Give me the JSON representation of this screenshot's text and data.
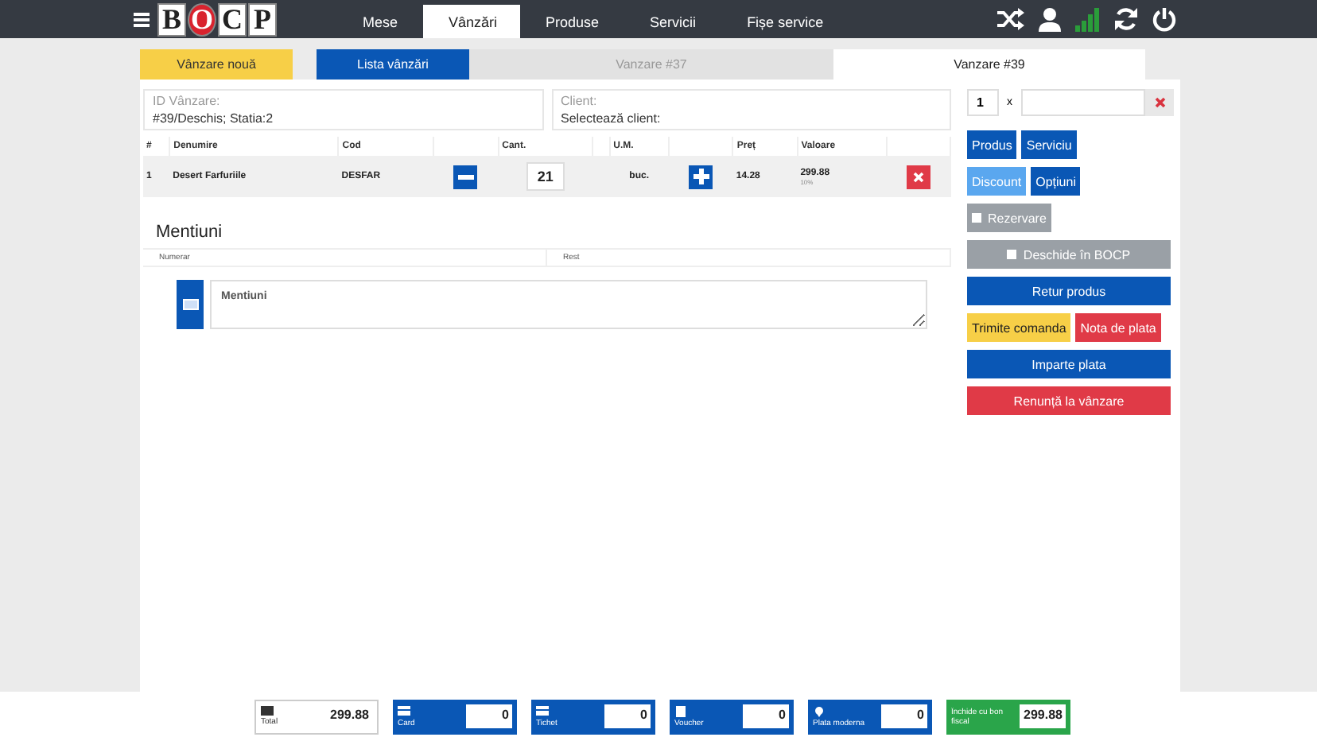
{
  "nav": {
    "logo": [
      "B",
      "O",
      "C",
      "P"
    ],
    "tabs": [
      {
        "label": "Mese",
        "selected": false
      },
      {
        "label": "Vânzări",
        "selected": true
      },
      {
        "label": "Produse",
        "selected": false
      },
      {
        "label": "Servicii",
        "selected": false
      },
      {
        "label": "Fișe service",
        "selected": false
      }
    ]
  },
  "sale_tabs": [
    {
      "label": "Vânzare nouă",
      "kind": "new"
    },
    {
      "label": "Lista vânzări",
      "kind": "list"
    },
    {
      "label": "Vanzare #37",
      "kind": "tab",
      "selected": false
    },
    {
      "label": "Vanzare #39",
      "kind": "tab",
      "selected": true
    }
  ],
  "info": [
    {
      "label": "ID Vânzare:",
      "value": "#39/Deschis; Statia:2"
    },
    {
      "label": "Client:",
      "value": "Selectează client:"
    }
  ],
  "table": {
    "columns": [
      "#",
      "Denumire",
      "Cod",
      "",
      "Cant.",
      "",
      "U.M.",
      "",
      "Preț",
      "Valoare",
      ""
    ],
    "rows": [
      {
        "index": "1",
        "name": "Desert Farfuriile",
        "code": "DESFAR",
        "qty": "21",
        "unit": "buc.",
        "price": "14.28",
        "value": "299.88",
        "note": "10%"
      }
    ]
  },
  "mentions": {
    "title": "Mentiuni",
    "numerar": "Numerar",
    "rest": "Rest",
    "placeholder": "Mentiuni"
  },
  "side": {
    "qty": "1",
    "times": "x",
    "buttons": [
      [
        {
          "label": "Produs",
          "color": "#0a57b5"
        },
        {
          "label": "Serviciu",
          "color": "#0a57b5"
        }
      ],
      [
        {
          "label": "Discount",
          "color": "#5aa7ef"
        },
        {
          "label": "Opțiuni",
          "color": "#0a57b5"
        }
      ],
      [
        {
          "label": "Rezervare",
          "color": "#9aa0a6",
          "kind": "toggle",
          "checked": false
        }
      ],
      [
        {
          "label": "Deschide în BOCP",
          "color": "#9aa0a6",
          "kind": "toggle",
          "checked": false
        }
      ],
      [
        {
          "label": "Retur produs",
          "color": "#0a57b5"
        }
      ],
      [
        {
          "label": "Trimite comanda",
          "color": "#f7cf47"
        },
        {
          "label": "Nota de plata",
          "color": "#e03a47"
        }
      ],
      [
        {
          "label": "Imparte plata",
          "color": "#0a57b5"
        }
      ],
      [
        {
          "label": "Renunță la vânzare",
          "color": "#e03a47"
        }
      ]
    ]
  },
  "payments": [
    {
      "kind": "total",
      "label": "Total",
      "value": "299.88"
    },
    {
      "kind": "method",
      "label": "Card",
      "value": "0"
    },
    {
      "kind": "method",
      "label": "Tichet",
      "value": "0"
    },
    {
      "kind": "method",
      "label": "Voucher",
      "value": "0"
    },
    {
      "kind": "method",
      "label": "Plata moderna",
      "value": "0"
    },
    {
      "kind": "fiscal",
      "label": "Închide cu bon fiscal",
      "value": "299.88"
    }
  ]
}
